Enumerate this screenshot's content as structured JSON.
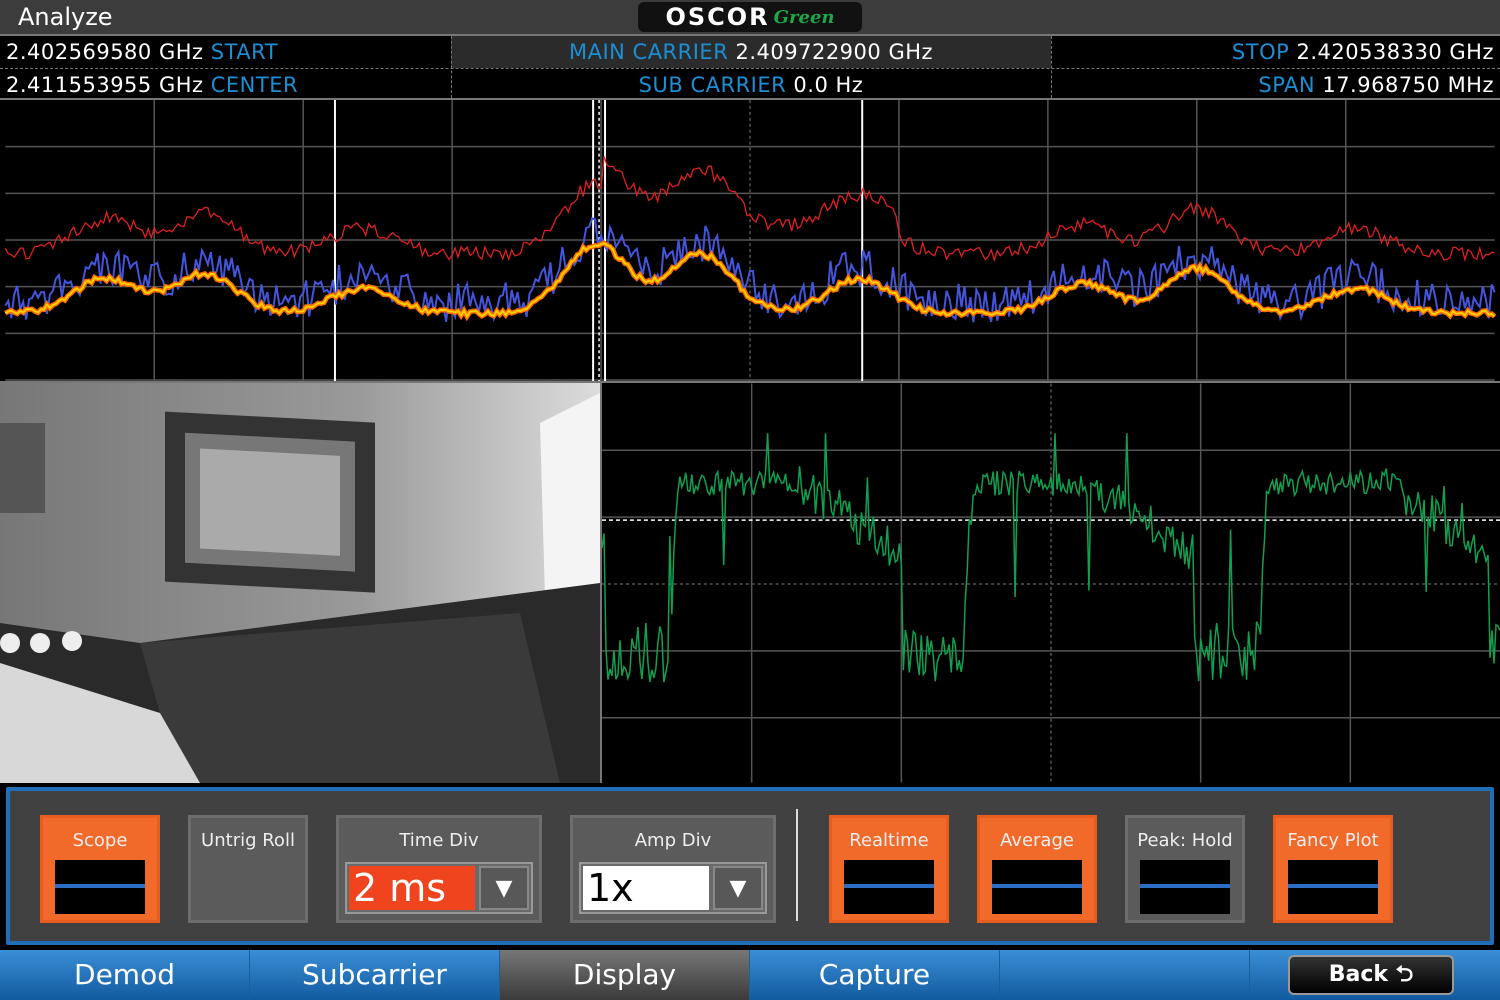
{
  "header": {
    "title": "Analyze",
    "logo_main": "OSCOR",
    "logo_sub": "Green"
  },
  "info": {
    "start_value": "2.402569580 GHz",
    "start_label": "START",
    "center_value": "2.411553955 GHz",
    "center_label": "CENTER",
    "main_carrier_label": "MAIN CARRIER",
    "main_carrier_value": "2.409722900 GHz",
    "sub_carrier_label": "SUB CARRIER",
    "sub_carrier_value": "0.0 Hz",
    "stop_label": "STOP",
    "stop_value": "2.420538330 GHz",
    "span_label": "SPAN",
    "span_value": "17.968750 MHz"
  },
  "colors": {
    "accent_blue": "#1b8fd6",
    "on_orange": "#f26a2a",
    "peak_trace": "#e02020",
    "realtime_trace": "#4455dd",
    "average_trace": "#ffcc00",
    "scope_trace": "#10a050"
  },
  "controls": {
    "scope": {
      "label": "Scope",
      "on": true
    },
    "untrig_roll": {
      "label": "Untrig Roll",
      "on": false
    },
    "time_div": {
      "label": "Time Div",
      "value": "2  ms"
    },
    "amp_div": {
      "label": "Amp Div",
      "value": "1x"
    },
    "realtime": {
      "label": "Realtime",
      "on": true
    },
    "average": {
      "label": "Average",
      "on": true
    },
    "peak_hold": {
      "label": "Peak: Hold",
      "on": false
    },
    "fancy_plot": {
      "label": "Fancy Plot",
      "on": true
    }
  },
  "tabs": [
    {
      "label": "Demod"
    },
    {
      "label": "Subcarrier"
    },
    {
      "label": "Display",
      "selected": true
    },
    {
      "label": "Capture"
    }
  ],
  "back_label": "Back ⮌"
}
